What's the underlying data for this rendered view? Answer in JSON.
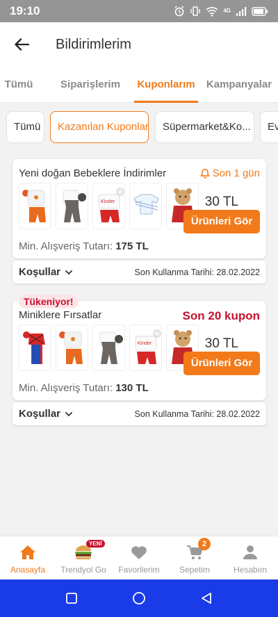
{
  "status_bar": {
    "time": "19:10",
    "network_label": "4G"
  },
  "header": {
    "title": "Bildirimlerim"
  },
  "tabs": [
    {
      "label": "Tümü",
      "active": false
    },
    {
      "label": "Siparişlerim",
      "active": false
    },
    {
      "label": "Kuponlarım",
      "active": true
    },
    {
      "label": "Kampanyalar",
      "active": false
    }
  ],
  "filters": [
    {
      "label": "Tümü",
      "active": false
    },
    {
      "label": "Kazanılan Kuponlar",
      "active": true
    },
    {
      "label": "Süpermarket&Ko...",
      "active": false
    },
    {
      "label": "Ev",
      "active": false
    }
  ],
  "coupons": [
    {
      "title": "Yeni doğan Bebeklere İndirimler",
      "time_badge": "Son 1 gün",
      "amount": "30 TL",
      "button_label": "Ürünleri Gör",
      "min_label": "Min. Alışveriş Tutarı:",
      "min_value": "175 TL",
      "conditions_label": "Koşullar",
      "expiry": "Son Kullanma Tarihi: 28.02.2022",
      "thumbnails": [
        "baby-set-orange",
        "baby-overall-gray",
        "baby-set-red-print",
        "baby-bodysuit-blue",
        "plush-bear"
      ]
    },
    {
      "title": "Miniklere Fırsatlar",
      "stock_tag": "Tükeniyor!",
      "coupon_badge": "Son 20 kupon",
      "amount": "30 TL",
      "button_label": "Ürünleri Gör",
      "min_label": "Min. Alışveriş Tutarı:",
      "min_value": "130 TL",
      "conditions_label": "Koşullar",
      "expiry": "Son Kullanma Tarihi: 28.02.2022",
      "thumbnails": [
        "spiderman-costume",
        "baby-set-orange",
        "baby-overall-gray",
        "baby-set-red-print",
        "plush-bear"
      ]
    }
  ],
  "bottom_nav": [
    {
      "label": "Anasayfa",
      "icon": "home-icon",
      "active": true
    },
    {
      "label": "Trendyol Go",
      "icon": "burger-icon",
      "badge": "YENİ",
      "active": false
    },
    {
      "label": "Favorilerim",
      "icon": "heart-icon",
      "active": false
    },
    {
      "label": "Sepetim",
      "icon": "cart-icon",
      "badge": "2",
      "active": false
    },
    {
      "label": "Hesabım",
      "icon": "user-icon",
      "active": false
    }
  ],
  "colors": {
    "accent": "#f27a1a",
    "alert_red": "#c8102e",
    "android_nav": "#1a3be8"
  }
}
